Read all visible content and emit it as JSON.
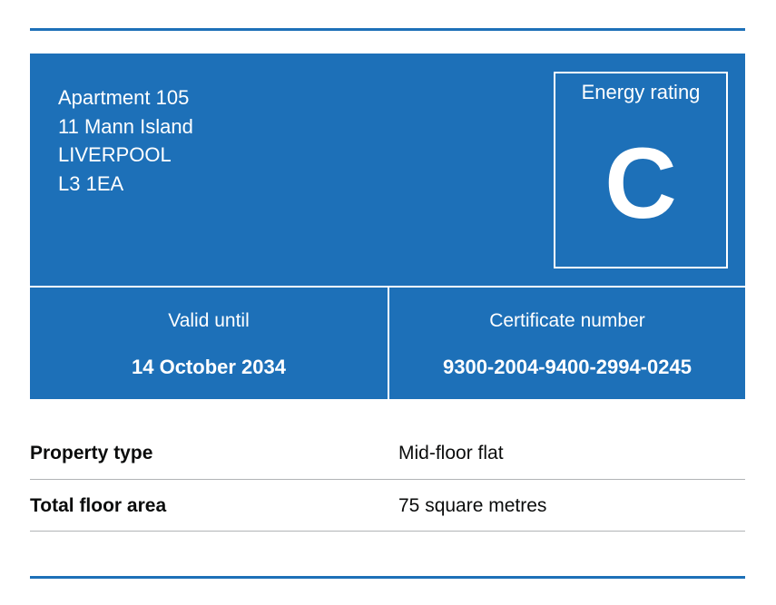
{
  "address": {
    "lines": [
      "Apartment 105",
      "11 Mann Island",
      "LIVERPOOL",
      "L3 1EA"
    ]
  },
  "energy_rating": {
    "label": "Energy rating",
    "value": "C"
  },
  "validity": {
    "label": "Valid until",
    "value": "14 October 2034"
  },
  "certificate": {
    "label": "Certificate number",
    "value": "9300-2004-9400-2994-0245"
  },
  "summary": {
    "rows": [
      {
        "key": "Property type",
        "value": "Mid-floor flat"
      },
      {
        "key": "Total floor area",
        "value": "75 square metres"
      }
    ]
  },
  "colors": {
    "panel": "#1d70b8",
    "text_on_panel": "#ffffff",
    "text": "#0b0c0c",
    "row_border": "#b1b4b6"
  }
}
